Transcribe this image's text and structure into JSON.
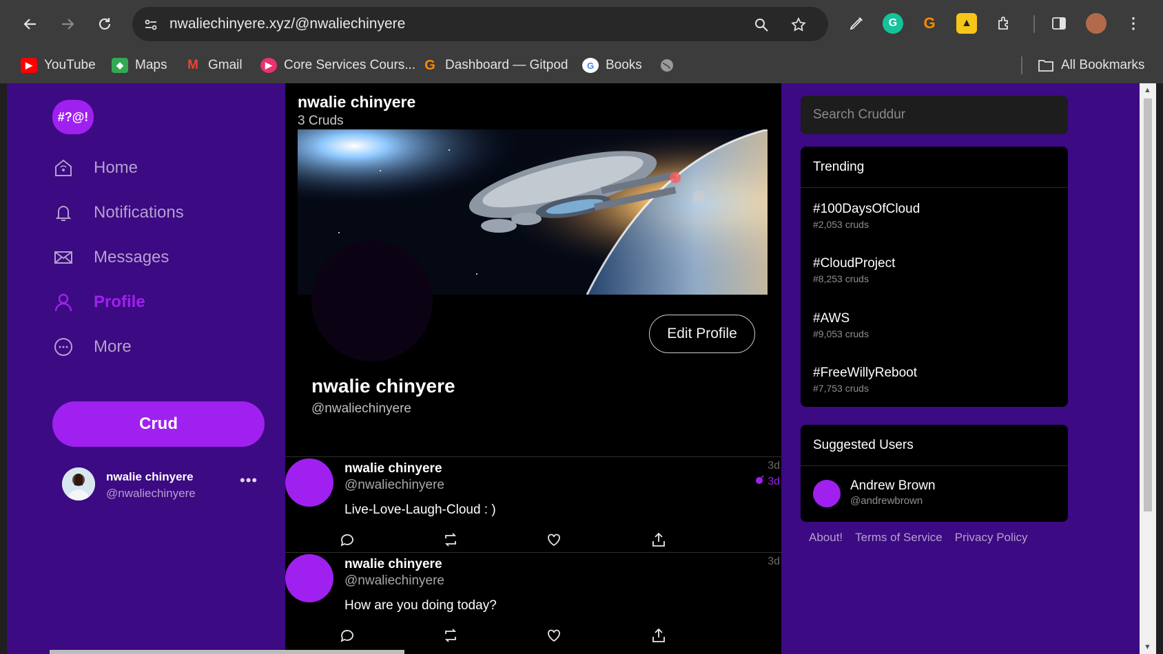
{
  "browser": {
    "url": "nwaliechinyere.xyz/@nwaliechinyere",
    "bookmarks": [
      {
        "label": "YouTube",
        "icon": "youtube-icon",
        "color": "#ff0000"
      },
      {
        "label": "Maps",
        "icon": "maps-icon",
        "color": "#34a853"
      },
      {
        "label": "Gmail",
        "icon": "gmail-icon",
        "color": "#ea4335"
      },
      {
        "label": "Core Services Cours...",
        "icon": "core-services-icon",
        "color": "#e8336d"
      },
      {
        "label": "Dashboard — Gitpod",
        "icon": "gitpod-icon",
        "color": "#ff8a00"
      },
      {
        "label": "Books",
        "icon": "google-icon",
        "color": "#4285f4"
      }
    ],
    "all_bookmarks": "All Bookmarks"
  },
  "sidebar": {
    "logo": "#?@!",
    "items": [
      {
        "label": "Home",
        "icon": "home-icon"
      },
      {
        "label": "Notifications",
        "icon": "bell-icon"
      },
      {
        "label": "Messages",
        "icon": "mail-icon"
      },
      {
        "label": "Profile",
        "icon": "user-icon",
        "active": true
      },
      {
        "label": "More",
        "icon": "more-circle-icon"
      }
    ],
    "crud_button": "Crud",
    "current_user": {
      "name": "nwalie chinyere",
      "handle": "@nwaliechinyere",
      "menu": "•••"
    }
  },
  "profile": {
    "header_name": "nwalie chinyere",
    "crud_count": "3 Cruds",
    "display_name": "nwalie chinyere",
    "handle": "@nwaliechinyere",
    "edit_button": "Edit Profile"
  },
  "posts": [
    {
      "name": "nwalie chinyere",
      "handle": "@nwaliechinyere",
      "text": "Live-Love-Laugh-Cloud : )",
      "time": "3d",
      "expires": "3d"
    },
    {
      "name": "nwalie chinyere",
      "handle": "@nwaliechinyere",
      "text": "How are you doing today?",
      "time": "3d"
    }
  ],
  "right": {
    "search_placeholder": "Search Cruddur",
    "trending_title": "Trending",
    "trending": [
      {
        "tag": "#100DaysOfCloud",
        "count": "#2,053 cruds"
      },
      {
        "tag": "#CloudProject",
        "count": "#8,253 cruds"
      },
      {
        "tag": "#AWS",
        "count": "#9,053 cruds"
      },
      {
        "tag": "#FreeWillyReboot",
        "count": "#7,753 cruds"
      }
    ],
    "suggested_title": "Suggested Users",
    "suggested": [
      {
        "name": "Andrew Brown",
        "handle": "@andrewbrown"
      }
    ],
    "footer": [
      "About!",
      "Terms of Service",
      "Privacy Policy"
    ]
  },
  "colors": {
    "accent": "#a020f0",
    "page_bg": "#3c0a82",
    "panel": "#000000"
  }
}
